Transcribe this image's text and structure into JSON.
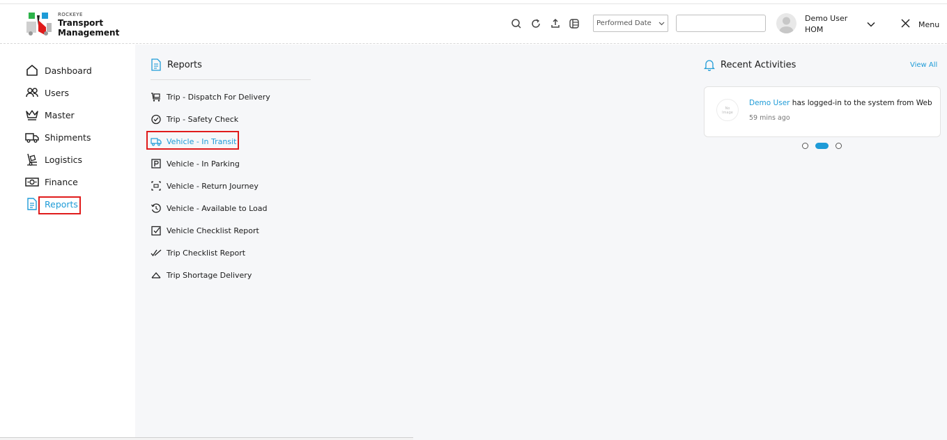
{
  "brand": {
    "small": "ROCKEYE",
    "line1": "Transport",
    "line2": "Management"
  },
  "header": {
    "date_filter": "Performed Date",
    "text_input_value": "",
    "user_name": "Demo User",
    "user_role": "HOM",
    "menu_label": "Menu"
  },
  "sidebar": {
    "items": [
      {
        "label": "Dashboard",
        "icon": "home-icon"
      },
      {
        "label": "Users",
        "icon": "users-icon"
      },
      {
        "label": "Master",
        "icon": "crown-icon"
      },
      {
        "label": "Shipments",
        "icon": "truck-icon"
      },
      {
        "label": "Logistics",
        "icon": "hand-truck-icon"
      },
      {
        "label": "Finance",
        "icon": "money-icon"
      },
      {
        "label": "Reports",
        "icon": "document-icon",
        "active": true
      }
    ]
  },
  "reports": {
    "title": "Reports",
    "items": [
      {
        "label": "Trip - Dispatch For Delivery",
        "icon": "cart-icon"
      },
      {
        "label": "Trip - Safety Check",
        "icon": "check-circle-icon"
      },
      {
        "label": "Vehicle - In Transit",
        "icon": "truck-icon",
        "active": true
      },
      {
        "label": "Vehicle - In Parking",
        "icon": "parking-icon"
      },
      {
        "label": "Vehicle - Return Journey",
        "icon": "return-icon"
      },
      {
        "label": "Vehicle - Available to Load",
        "icon": "history-icon"
      },
      {
        "label": "Vehicle Checklist Report",
        "icon": "checkbox-icon"
      },
      {
        "label": "Trip Checklist Report",
        "icon": "double-check-icon"
      },
      {
        "label": "Trip Shortage Delivery",
        "icon": "triangle-icon"
      }
    ]
  },
  "recent": {
    "title": "Recent Activities",
    "view_all": "View All",
    "no_image_line1": "No",
    "no_image_line2": "Image",
    "user": "Demo User",
    "message": " has logged-in to the system from Web",
    "time": "59 mins ago"
  },
  "colors": {
    "accent": "#1e9bd7",
    "highlight": "#e01b1b",
    "background": "#f6f7f9"
  }
}
